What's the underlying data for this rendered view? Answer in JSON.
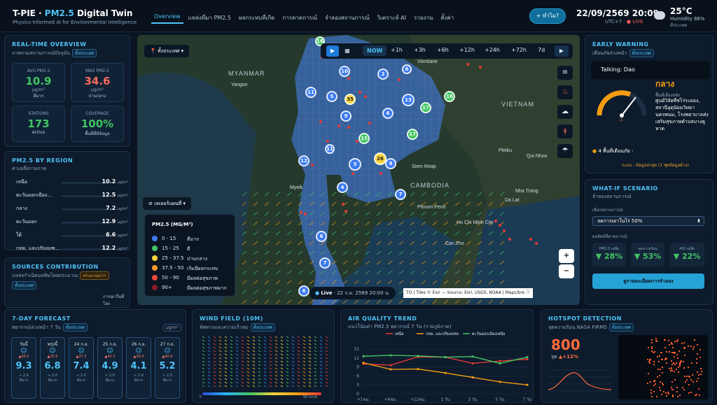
{
  "header": {
    "brand_a": "T-PIE · ",
    "brand_b": "PM2.5",
    "brand_c": " Digital Twin",
    "subtitle": "Physics-Informed AI for Environmental Intelligence",
    "nav": [
      "Overview",
      "แหล่งที่มา PM2.5",
      "ผลกระทบที่เกิด",
      "การคาดการณ์",
      "จำลองสถานการณ์",
      "วิเคราะห์ AI",
      "รายงาน",
      "ตั้งค่า"
    ],
    "ask": "+ ทำไม?",
    "datetime": "22/09/2569 20:09",
    "tz": "UTC+7 · ",
    "live": "● LIVE",
    "temp": "25°C",
    "humidity": "Humidity 86%",
    "humidity_sub": "ที่ประเทศ"
  },
  "overview": {
    "title": "REAL-TIME OVERVIEW",
    "sub": "ภาพรวมสถานการณ์ปัจจุบัน",
    "tag": "ทั้งประเทศ",
    "avg_label": "AVG PM2.5",
    "avg_value": "10.9",
    "avg_unit": "μg/m³",
    "avg_status": "ดีมาก",
    "max_label": "MAX PM2.5",
    "max_value": "34.6",
    "max_unit": "μg/m³",
    "max_status": "ปานกลาง",
    "stations_label": "STATIONS",
    "stations_value": "173",
    "stations_status": "Active",
    "coverage_label": "COVERAGE",
    "coverage_value": "100%",
    "coverage_status": "พื้นที่ที่มีข้อมูล"
  },
  "region": {
    "title": "PM2.5 BY REGION",
    "sub": "ค่าเฉลี่ยรายภาค",
    "unit": "μg/m³",
    "rows": [
      {
        "name": "เหนือ",
        "value": "10.2"
      },
      {
        "name": "ตะวันออกเฉียง...",
        "value": "12.5"
      },
      {
        "name": "กลาง",
        "value": "7.2"
      },
      {
        "name": "ตะวันออก",
        "value": "12.9"
      },
      {
        "name": "ใต้",
        "value": "6.6"
      },
      {
        "name": "กทม. และปริมณฑ...",
        "value": "12.2"
      }
    ]
  },
  "sources": {
    "title": "SOURCES CONTRIBUTION",
    "sub": "แหล่งกำเนิดมลพิษโดยประมาณ",
    "tag_a": "ประมาณการ",
    "tag_b": "ทั้งประเทศ",
    "note": "การเผาในที่โล่ง"
  },
  "map": {
    "area_btn": "ทั้งประเทศ",
    "times": [
      "NOW",
      "+1h",
      "+3h",
      "+6h",
      "+12h",
      "+24h",
      "+72h",
      "7d"
    ],
    "layers_btn": "เลเยอร์แผนที่",
    "legend_title": "PM2.5 (MG/M³)",
    "legend": [
      {
        "range": "0 - 15",
        "label": "ดีมาก",
        "color": "#3d7bf0"
      },
      {
        "range": "15 - 25",
        "label": "ดี",
        "color": "#43c463"
      },
      {
        "range": "25 - 37.5",
        "label": "ปานกลาง",
        "color": "#f5d33b"
      },
      {
        "range": "37.5 - 50",
        "label": "เริ่มมีผลกระทบ",
        "color": "#f59a2b"
      },
      {
        "range": "50 - 90",
        "label": "มีผลต่อสุขภาพ",
        "color": "#ec4a3b"
      },
      {
        "range": "90+",
        "label": "มีผลต่อสุขภาพมาก",
        "color": "#8e1b2d"
      }
    ],
    "places": [
      "MYANMAR",
      "Yangon",
      "VIETNAM",
      "CAMBODIA",
      "Siem Reap",
      "Phnom Penh",
      "Ho Chi Minh City",
      "Can Tho",
      "Pleiku",
      "Qui Nhon",
      "Nha Trang",
      "Da Lat",
      "Myeik",
      "Vientiane"
    ],
    "live_label": "Live",
    "live_time": "22 ก.ย. 2569 20:00 น.",
    "attribution": "TO | Tiles © Esri — Source: Esri, USGS, NOAA | MapLibre",
    "clusters": [
      "16",
      "10",
      "2",
      "6",
      "11",
      "5",
      "35",
      "13",
      "17",
      "16",
      "9",
      "6",
      "11",
      "12",
      "15",
      "8",
      "17",
      "26",
      "5",
      "4",
      "7",
      "6",
      "7",
      "6"
    ]
  },
  "warning": {
    "title": "EARLY WARNING",
    "sub": "เตือนภัยล่วงหน้า",
    "tag": "ทั้งประเทศ",
    "tooltip": "Talking: Dao",
    "level": "กลาง",
    "area_label": "พื้นที่เสี่ยงหลัก",
    "area_text": "ศูนย์วิจัยพืชไร่ระยอง, สถานีอุตุนิยมวิทยานครพนม, โรงพยาบาลส่งเสริมสุขภาพตำบลบางคูหาด",
    "count": "4 พื้นที่เตือนภัย",
    "source": "ระบบ - ข้อมูลล่าสุด (1 ชุดข้อมูลด้าง)"
  },
  "whatif": {
    "title": "WHAT-IF SCENARIO",
    "sub": "จำลองสถานการณ์",
    "select_label": "เลือกสถานการณ์",
    "selected": "ลดการเผาในไร่ 50%",
    "effect_label": "ผลลัพธ์ที่คาดการณ์",
    "e1_label": "PM2.5 เฉลี่ย",
    "e1_value": "▼ 28%",
    "e2_label": "จุดความร้อน",
    "e2_value": "▼ 53%",
    "e3_label": "AQI เฉลี่ย",
    "e3_value": "▼ 22%",
    "run": "ดูรายละเอียดการจำลอง"
  },
  "forecast": {
    "title": "7-DAY FORECAST",
    "sub": "พยากรณ์ล่วงหน้า 7 วัน",
    "tag": "ทั้งประเทศ",
    "unit": "μg/m³",
    "days": [
      {
        "day": "วันนี้",
        "max": "▲69.0",
        "value": "9.3",
        "wind": "≈ 2.0",
        "status": "ดีมาก"
      },
      {
        "day": "พรุ่งนี้",
        "max": "▲35.6",
        "value": "6.8",
        "wind": "≈ 2.0",
        "status": "ดีมาก"
      },
      {
        "day": "24 ก.ย.",
        "max": "▲37.3",
        "value": "7.4",
        "wind": "≈ 2.0",
        "status": "ดีมาก"
      },
      {
        "day": "25 ก.ย.",
        "max": "▲43.3",
        "value": "4.9",
        "wind": "≈ 2.0",
        "status": "ดีมาก"
      },
      {
        "day": "26 ก.ย.",
        "max": "▲36.9",
        "value": "4.1",
        "wind": "≈ 2.0",
        "status": "ดีมาก"
      },
      {
        "day": "27 ก.ย.",
        "max": "▲40.6",
        "value": "5.2",
        "wind": "≈ 2.0",
        "status": "ดีมาก"
      }
    ]
  },
  "wind": {
    "title": "WIND FIELD (10M)",
    "sub": "ทิศทางและความเร็วลม",
    "tag": "ทั้งประเทศ",
    "scale_min": "0",
    "scale_max": "50 km/h"
  },
  "trend": {
    "title": "AIR QUALITY TREND",
    "sub": "แนวโน้มค่า PM2.5 พยากรณ์ 7 วัน (รายภูมิภาค)"
  },
  "chart_data": {
    "type": "line",
    "x": [
      "+1ชม.",
      "+6ชม.",
      "+12ชม.",
      "1 วัน",
      "3 วัน",
      "5 วัน",
      "7 วัน"
    ],
    "yticks": [
      "15",
      "12",
      "9",
      "6",
      "3",
      "0"
    ],
    "ylim": [
      0,
      15
    ],
    "series": [
      {
        "name": "เหนือ",
        "color": "#e53935",
        "values": [
          10,
          9.6,
          12.4,
          12.3,
          10.2,
          11.0,
          11.6
        ]
      },
      {
        "name": "กทม. และปริมณฑล",
        "color": "#f39c12",
        "values": [
          10.4,
          8.2,
          8.3,
          7.0,
          5.5,
          4.0,
          3.0
        ]
      },
      {
        "name": "ตะวันออกเฉียงเหนือ",
        "color": "#43c463",
        "values": [
          12.6,
          12.9,
          12.7,
          12.3,
          12.5,
          10.2,
          12.3
        ]
      }
    ]
  },
  "hotspot": {
    "title": "HOTSPOT DETECTION",
    "sub": "จุดความร้อน NASA FIRMS",
    "tag": "ทั้งประเทศ",
    "count": "800",
    "unit": "จุด",
    "change": "▲+12%"
  }
}
